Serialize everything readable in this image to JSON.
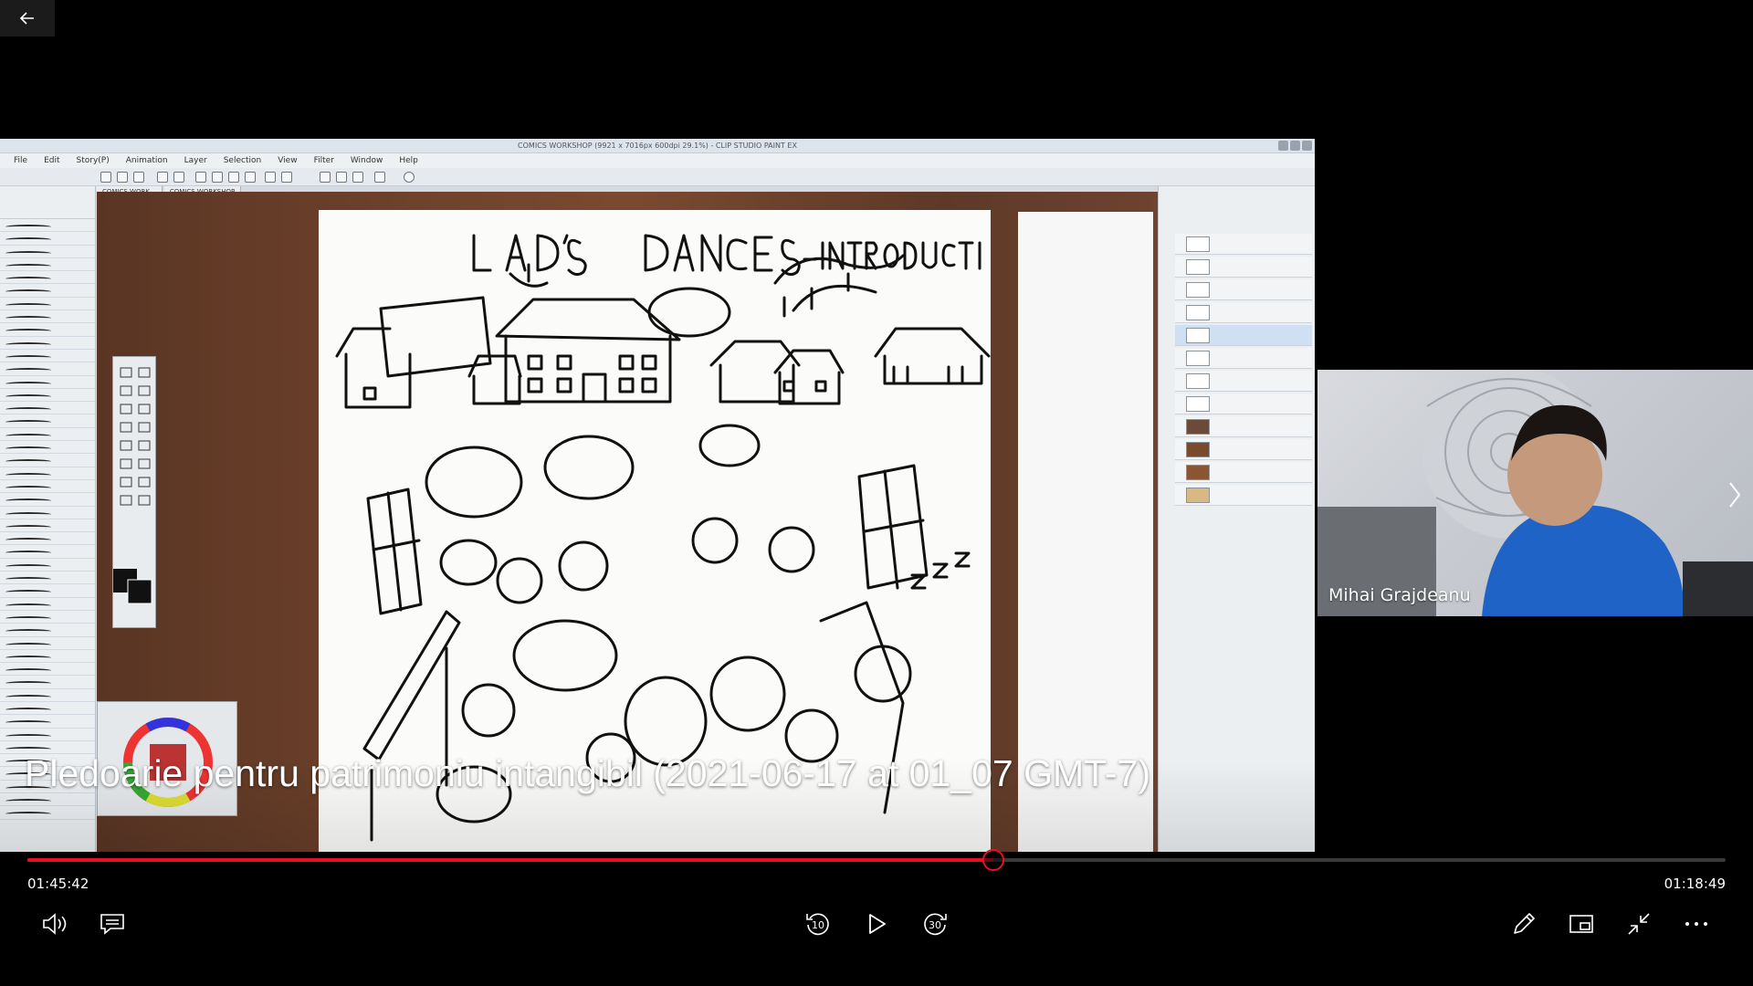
{
  "video": {
    "title": "Pledoarie pentru patrimoniu intangibil (2021-06-17 at 01_07 GMT-7)",
    "elapsed": "01:45:42",
    "remaining": "01:18:49",
    "progress_fraction": 0.569
  },
  "participant": {
    "name": "Mihai Grajdeanu"
  },
  "shared_app": {
    "window_title": "COMICS WORKSHOP (9921 x 7016px 600dpi 29.1%) - CLIP STUDIO PAINT EX",
    "menu": [
      "File",
      "Edit",
      "Story(P)",
      "Animation",
      "Layer",
      "Selection",
      "View",
      "Filter",
      "Window",
      "Help"
    ],
    "tabs": [
      "COMICS WORK...",
      "COMICS WORKSHOP"
    ]
  },
  "colors": {
    "progress": "#e81123",
    "background": "#000000"
  },
  "icons": {
    "back": "arrow-left-icon",
    "next": "chevron-right-icon",
    "volume": "volume-icon",
    "captions": "captions-icon",
    "rewind": "rewind-10-icon",
    "play": "play-icon",
    "forward": "forward-30-icon",
    "edit": "pencil-icon",
    "miniplayer": "miniplayer-icon",
    "exit_fullscreen": "exit-fullscreen-icon",
    "more": "more-icon"
  }
}
